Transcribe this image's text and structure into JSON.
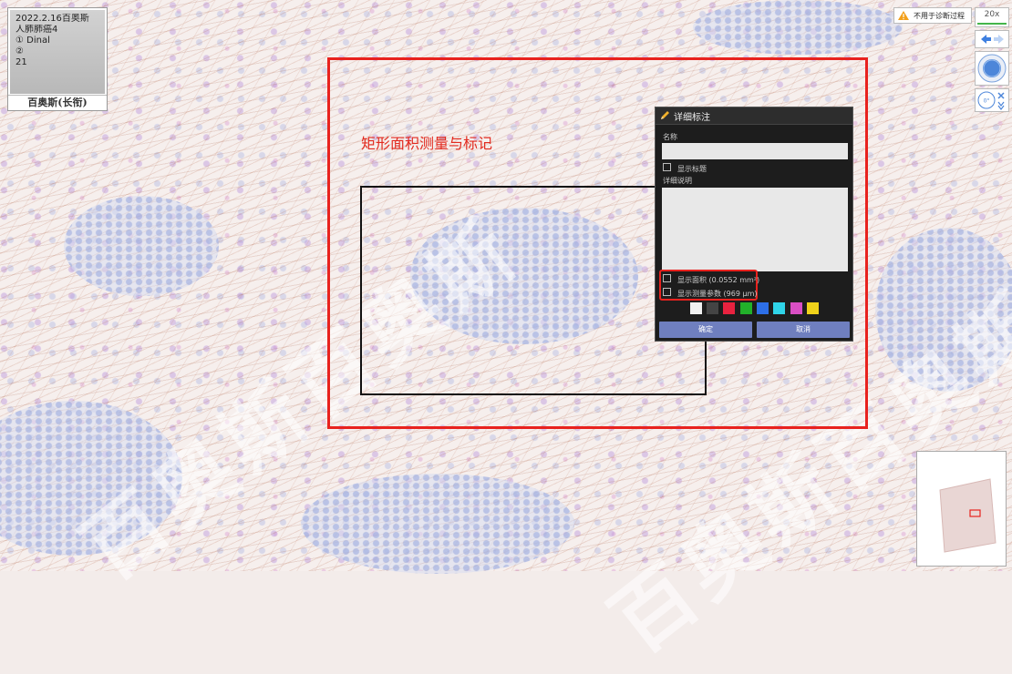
{
  "slide_label": {
    "lines": [
      "2022.2.16百奥斯",
      "人肺肺癌4",
      "① Dinal",
      "②  ",
      "21"
    ],
    "caption": "百奥斯(长衔)"
  },
  "annotation": {
    "title": "矩形面积测量与标记",
    "outer_color": "#e8221e",
    "inner_color": "#111111"
  },
  "dialog": {
    "title": "详细标注",
    "name_label": "名称",
    "name_value": "",
    "show_title_label": "显示标题",
    "detail_label": "详细说明",
    "detail_value": "",
    "show_area_label": "显示面积 (0.0552 mm²)",
    "show_measure_label": "显示测量参数 (969 µm)",
    "swatches": [
      "#f0f0f0",
      "#444444",
      "#e8223f",
      "#22b02a",
      "#2d6fe8",
      "#2fd4e8",
      "#d94fc4",
      "#f0d21a"
    ],
    "confirm_label": "确定",
    "cancel_label": "取消"
  },
  "toolbar": {
    "warning_text": "不用于诊断过程",
    "zoom_text": "20x",
    "rotate_text": "0°"
  },
  "icons": {
    "warning": "warning-triangle-icon",
    "back": "arrow-left-icon",
    "forward": "arrow-right-icon",
    "rotate": "rotate-icon"
  }
}
